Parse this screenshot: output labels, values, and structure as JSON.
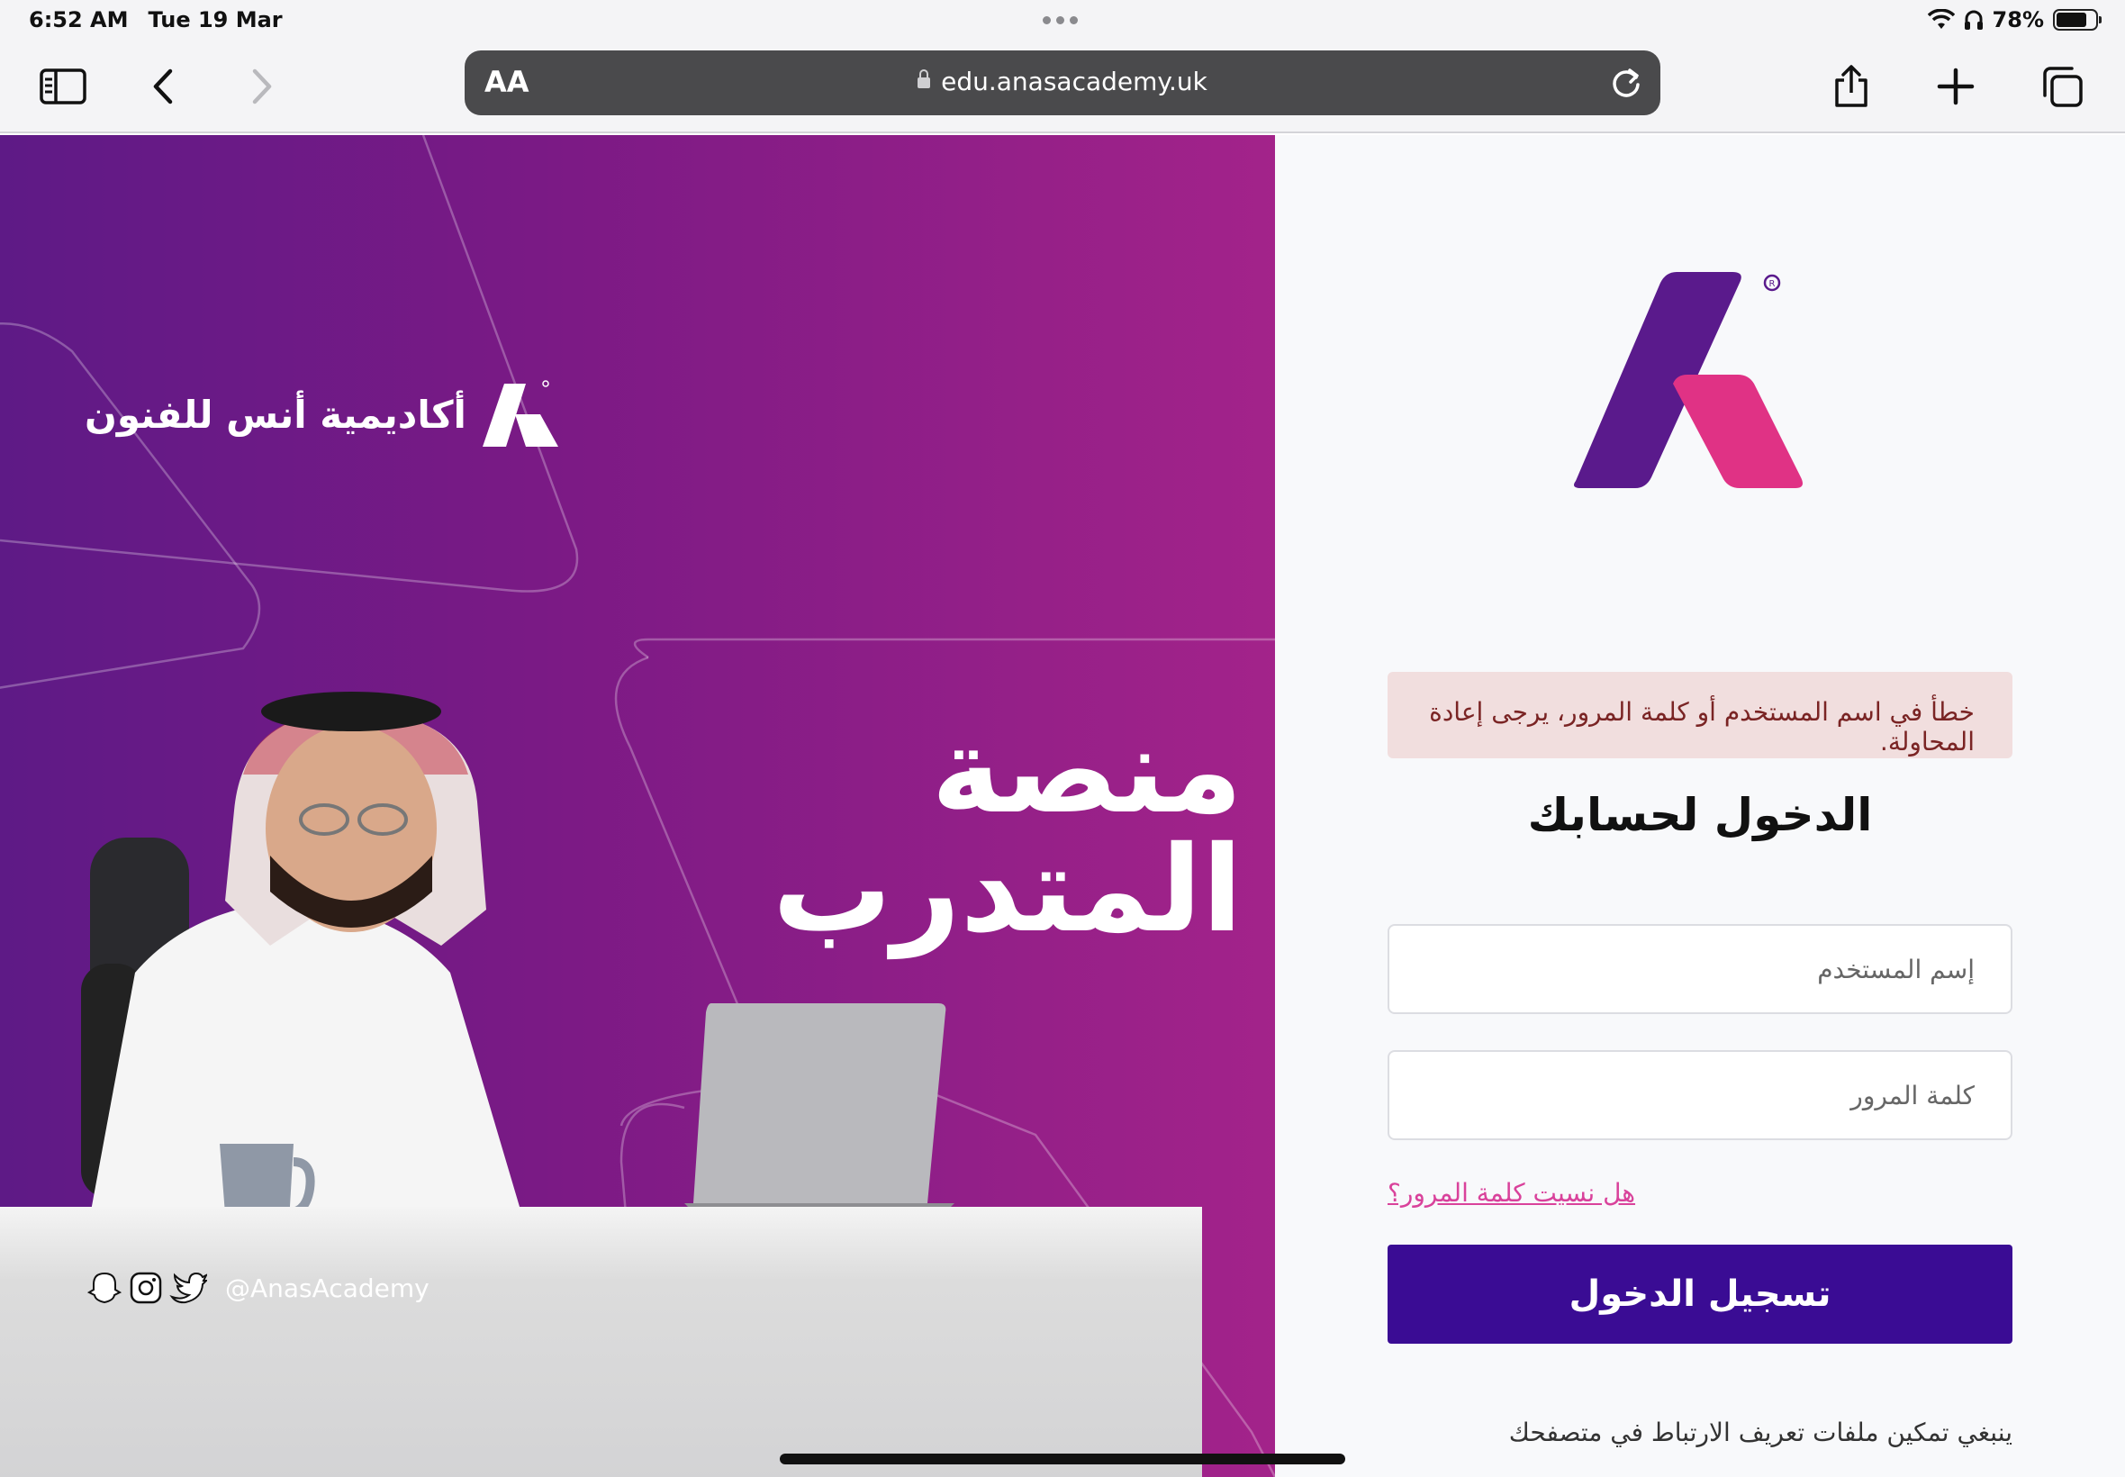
{
  "status_bar": {
    "time": "6:52 AM",
    "date": "Tue 19 Mar",
    "battery": "78%",
    "battery_level": 0.78,
    "icons": [
      "wifi-icon",
      "headphones-icon",
      "battery-icon"
    ]
  },
  "browser": {
    "text_size_label": "AA",
    "url": "edu.anasacademy.uk",
    "buttons": [
      "sidebar-icon",
      "back-icon",
      "forward-icon",
      "share-icon",
      "new-tab-icon",
      "tabs-icon",
      "reload-icon"
    ]
  },
  "promo": {
    "brand_name": "أكاديمية أنس للفنون",
    "headline": "منصة المتدرب",
    "social_handle": "@AnasAcademy",
    "social_icons": [
      "snapchat-icon",
      "instagram-icon",
      "twitter-icon"
    ],
    "colors": {
      "gradient_start": "#5e1a86",
      "gradient_end": "#a3238a"
    }
  },
  "login": {
    "error_message": "خطأ في اسم المستخدم أو كلمة المرور، يرجى إعادة المحاولة.",
    "title": "الدخول لحسابك",
    "username_placeholder": "إسم المستخدم",
    "password_placeholder": "كلمة المرور",
    "forgot_password": "هل نسيت كلمة المرور؟",
    "submit_label": "تسجيل الدخول",
    "cookie_notice": "ينبغي تمكين ملفات تعريف الارتباط في متصفحك",
    "colors": {
      "primary": "#3a0c94",
      "logo_purple": "#5a1a8c",
      "logo_pink": "#e03285",
      "link": "#d9429b",
      "alert_bg": "#f1dede"
    }
  }
}
